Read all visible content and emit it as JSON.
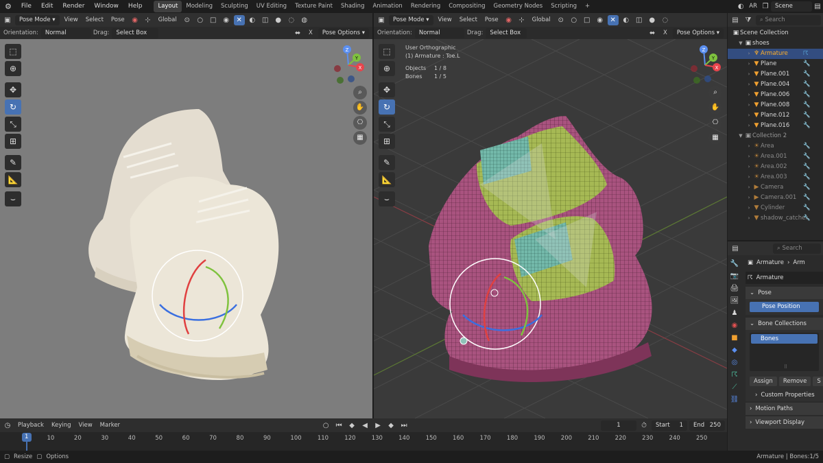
{
  "topbar": {
    "menus": [
      "File",
      "Edit",
      "Render",
      "Window",
      "Help"
    ],
    "workspaces": [
      "Layout",
      "Modeling",
      "Sculpting",
      "UV Editing",
      "Texture Paint",
      "Shading",
      "Animation",
      "Rendering",
      "Compositing",
      "Geometry Nodes",
      "Scripting"
    ],
    "active_workspace": "Layout",
    "add_label": "+",
    "ar_label": "AR",
    "scene_label": "Scene"
  },
  "viewport_left": {
    "mode": "Pose Mode",
    "menus": [
      "View",
      "Select",
      "Pose"
    ],
    "transform": "Global",
    "orientation_label": "Orientation:",
    "orientation_value": "Normal",
    "drag_label": "Drag:",
    "drag_value": "Select Box",
    "x_label": "X",
    "options": "Pose Options"
  },
  "viewport_right": {
    "mode": "Pose Mode",
    "menus": [
      "View",
      "Select",
      "Pose"
    ],
    "transform": "Global",
    "orientation_label": "Orientation:",
    "orientation_value": "Normal",
    "drag_label": "Drag:",
    "drag_value": "Select Box",
    "x_label": "X",
    "options": "Pose Options",
    "overlay_title": "User Orthographic",
    "overlay_sub": "(1) Armature : Toe.L",
    "objects_label": "Objects",
    "objects_value": "1 / 8",
    "bones_label": "Bones",
    "bones_value": "1 / 5"
  },
  "gizmo": {
    "z": "Z",
    "y": "Y",
    "x": "X"
  },
  "outliner": {
    "search_placeholder": "Search",
    "root": "Scene Collection",
    "collection1": "shoes",
    "items1": [
      "Armature",
      "Plane",
      "Plane.001",
      "Plane.004",
      "Plane.006",
      "Plane.008",
      "Plane.012",
      "Plane.016"
    ],
    "collection2": "Collection 2",
    "items2": [
      "Area",
      "Area.001",
      "Area.002",
      "Area.003",
      "Camera",
      "Camera.001",
      "Cylinder",
      "shadow_catcher"
    ]
  },
  "properties": {
    "search_placeholder": "Search",
    "breadcrumb_1": "Armature",
    "breadcrumb_2": "Arm",
    "data_name": "Armature",
    "pose_panel": "Pose",
    "pose_position": "Pose Position",
    "bone_collections_panel": "Bone Collections",
    "bones_item": "Bones",
    "assign": "Assign",
    "remove": "Remove",
    "s_btn": "S",
    "custom_properties": "Custom Properties",
    "motion_paths": "Motion Paths",
    "viewport_display": "Viewport Display"
  },
  "timeline": {
    "menus": [
      "Playback",
      "Keying",
      "View",
      "Marker"
    ],
    "current_frame": "1",
    "start_label": "Start",
    "start_value": "1",
    "end_label": "End",
    "end_value": "250",
    "ticks": [
      "1",
      "10",
      "20",
      "30",
      "40",
      "50",
      "60",
      "70",
      "80",
      "90",
      "100",
      "110",
      "120",
      "130",
      "140",
      "150",
      "160",
      "170",
      "180",
      "190",
      "200",
      "210",
      "220",
      "230",
      "240",
      "250"
    ]
  },
  "statusbar": {
    "resize": "Resize",
    "options": "Options",
    "info": "Armature | Bones:1/5"
  },
  "colors": {
    "accent": "#4772b3",
    "active_object": "#ffaf29",
    "mesh_pink": "#a9537f",
    "mesh_green": "#9fb84e",
    "mesh_teal": "#6fb8a8"
  }
}
